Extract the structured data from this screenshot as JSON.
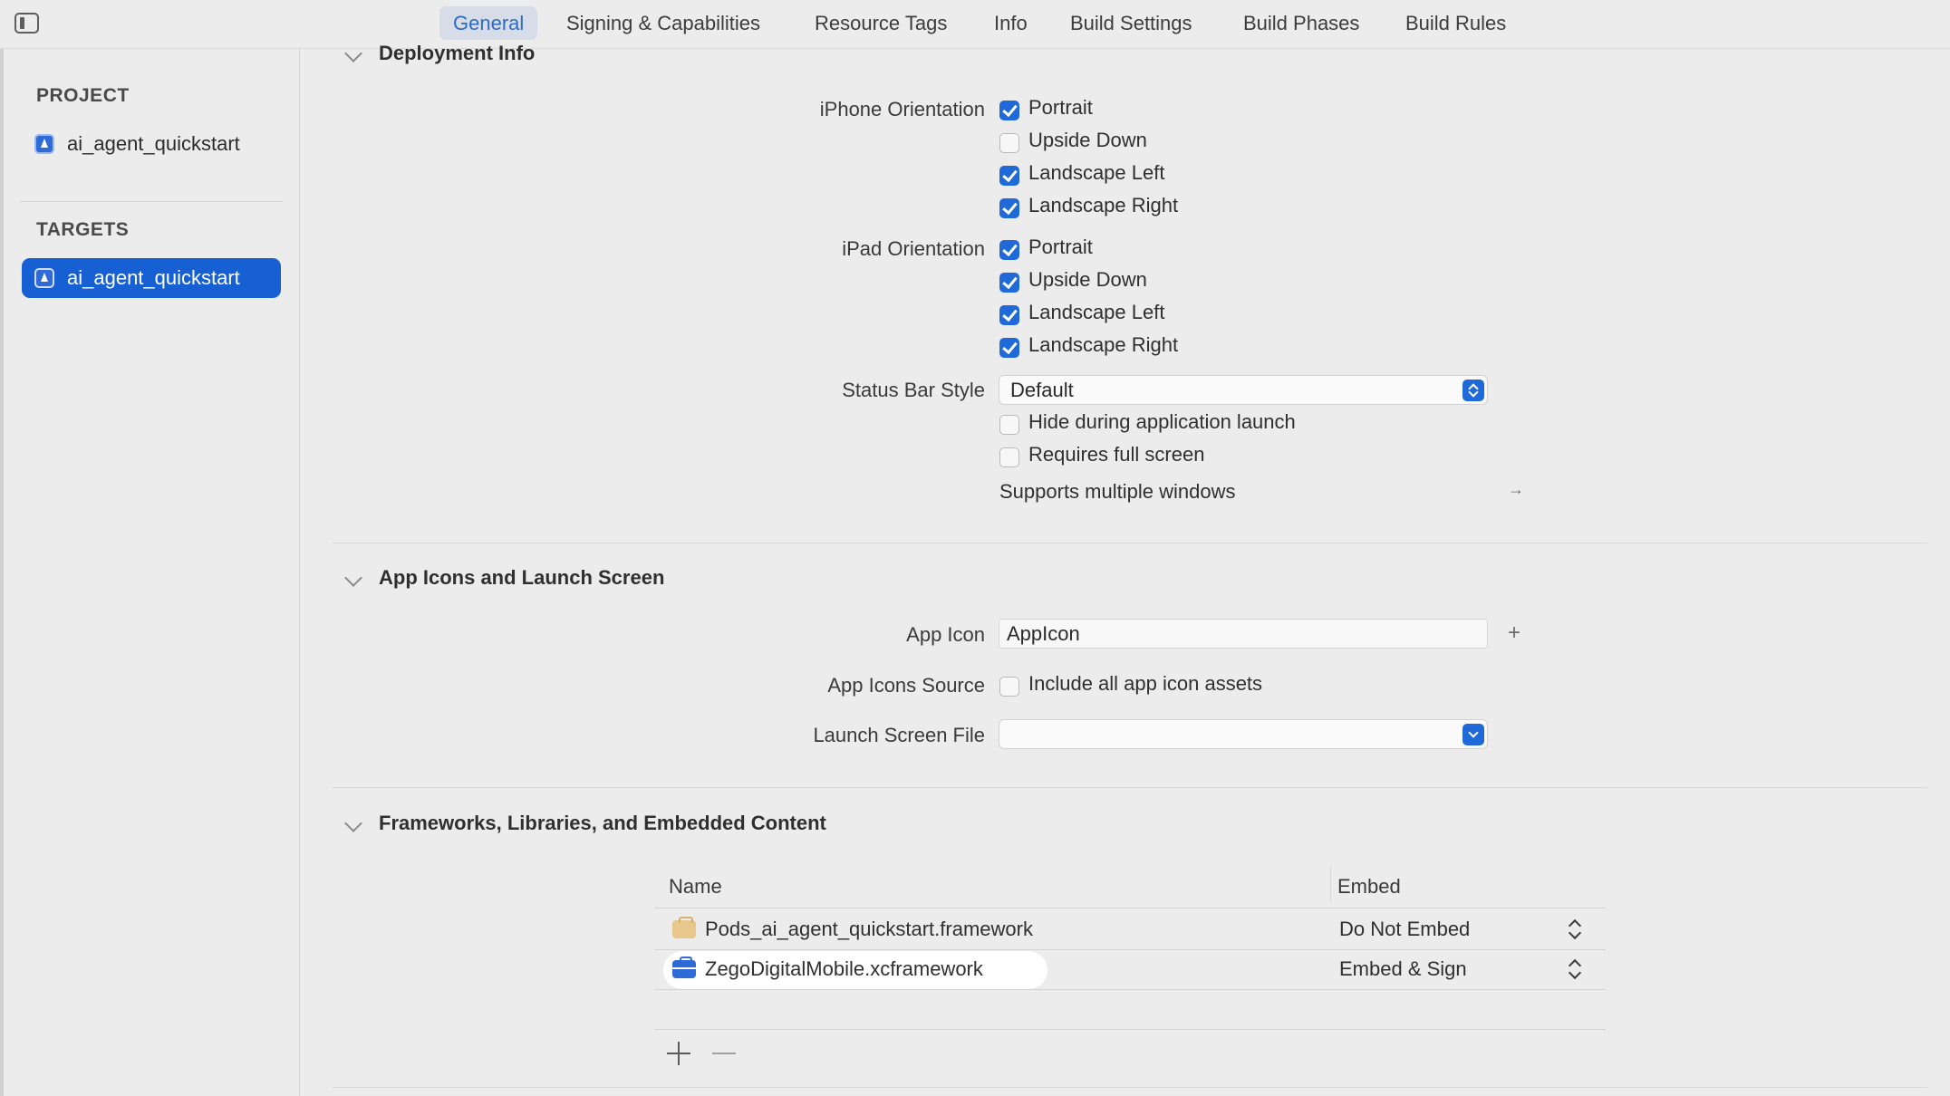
{
  "tabs": [
    "General",
    "Signing & Capabilities",
    "Resource Tags",
    "Info",
    "Build Settings",
    "Build Phases",
    "Build Rules"
  ],
  "navigator": {
    "project_header": "PROJECT",
    "project_item": "ai_agent_quickstart",
    "targets_header": "TARGETS",
    "target_item": "ai_agent_quickstart"
  },
  "deployment": {
    "title": "Deployment Info",
    "iphone_label": "iPhone Orientation",
    "iphone_options": [
      {
        "label": "Portrait",
        "checked": true
      },
      {
        "label": "Upside Down",
        "checked": false
      },
      {
        "label": "Landscape Left",
        "checked": true
      },
      {
        "label": "Landscape Right",
        "checked": true
      }
    ],
    "ipad_label": "iPad Orientation",
    "ipad_options": [
      {
        "label": "Portrait",
        "checked": true
      },
      {
        "label": "Upside Down",
        "checked": true
      },
      {
        "label": "Landscape Left",
        "checked": true
      },
      {
        "label": "Landscape Right",
        "checked": true
      }
    ],
    "status_bar_label": "Status Bar Style",
    "status_bar_value": "Default",
    "hide_launch_label": "Hide during application launch",
    "hide_launch_checked": false,
    "full_screen_label": "Requires full screen",
    "full_screen_checked": false,
    "multiple_windows_label": "Supports multiple windows"
  },
  "app_icons": {
    "title": "App Icons and Launch Screen",
    "app_icon_label": "App Icon",
    "app_icon_value": "AppIcon",
    "icons_source_label": "App Icons Source",
    "include_all_label": "Include all app icon assets",
    "include_all_checked": false,
    "launch_screen_label": "Launch Screen File",
    "launch_screen_value": ""
  },
  "frameworks": {
    "title": "Frameworks, Libraries, and Embedded Content",
    "col_name": "Name",
    "col_embed": "Embed",
    "rows": [
      {
        "name": "Pods_ai_agent_quickstart.framework",
        "embed": "Do Not Embed",
        "icon": "framework-package-icon"
      },
      {
        "name": "ZegoDigitalMobile.xcframework",
        "embed": "Embed & Sign",
        "icon": "xcframework-toolbox-icon"
      }
    ]
  },
  "colors": {
    "accent": "#1f6ad8",
    "selected_row": "#1760d4",
    "active_tab_bg": "#d6dde9"
  }
}
